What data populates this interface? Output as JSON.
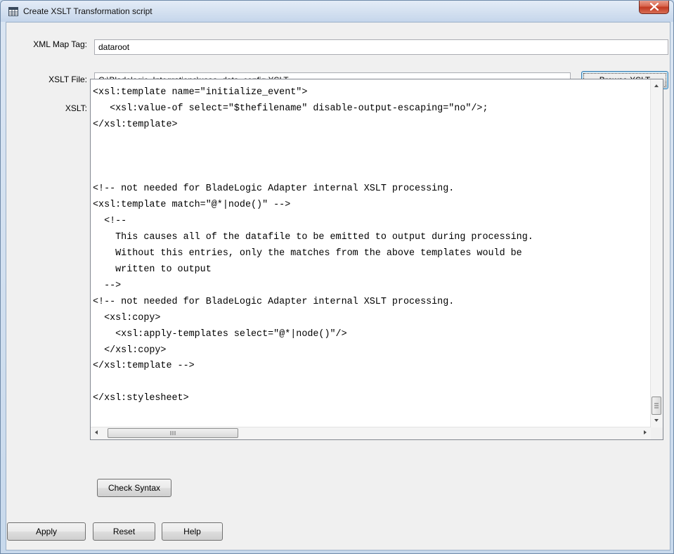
{
  "window": {
    "title": "Create XSLT Transformation script"
  },
  "form": {
    "xml_map_tag_label": "XML Map Tag:",
    "xml_map_tag_value": "dataroot",
    "xslt_file_label": "XSLT File:",
    "xslt_file_value": "C:\\Bladelogic_Integrations\\usaa_data_config.XSLT",
    "browse_label": "Browse XSLT",
    "xslt_label": "XSLT:"
  },
  "editor": {
    "code": "<xsl:template name=\"initialize_event\">\n   <xsl:value-of select=\"$thefilename\" disable-output-escaping=\"no\"/>;\n</xsl:template>\n\n\n\n<!-- not needed for BladeLogic Adapter internal XSLT processing.\n<xsl:template match=\"@*|node()\" -->\n  <!--\n    This causes all of the datafile to be emitted to output during processing.\n    Without this entries, only the matches from the above templates would be\n    written to output\n  -->\n<!-- not needed for BladeLogic Adapter internal XSLT processing.\n  <xsl:copy>\n    <xsl:apply-templates select=\"@*|node()\"/>\n  </xsl:copy>\n</xsl:template -->\n\n</xsl:stylesheet>"
  },
  "buttons": {
    "check_syntax": "Check Syntax",
    "apply": "Apply",
    "reset": "Reset",
    "help": "Help"
  },
  "icons": {
    "window_icon": "table-window-icon",
    "close": "close-icon",
    "scroll_up": "arrow-up-icon",
    "scroll_down": "arrow-down-icon",
    "scroll_left": "arrow-left-icon",
    "scroll_right": "arrow-right-icon",
    "grip": "scroll-grip-icon"
  },
  "colors": {
    "close_button": "#c8402a",
    "frame": "#c9dbee",
    "focus_border": "#3c7fb1"
  }
}
